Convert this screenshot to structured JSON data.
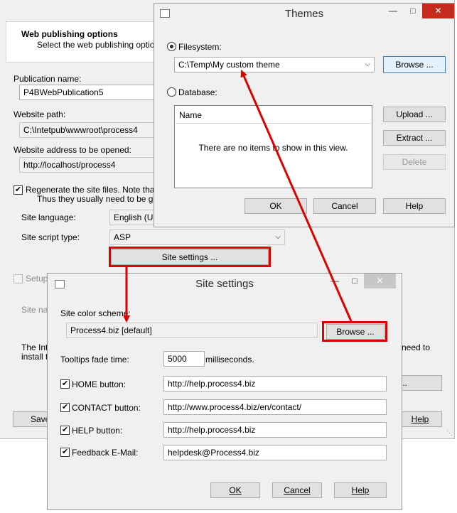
{
  "main_window": {
    "section_title": "Web publishing options",
    "section_subtitle": "Select the web publishing options.",
    "publication_name_label": "Publication name:",
    "publication_name_value": "P4BWebPublication5",
    "website_path_label": "Website path:",
    "website_path_value": "C:\\Intetpub\\wwwroot\\process4",
    "website_address_label": "Website address to be opened:",
    "website_address_value": "http://localhost/process4",
    "regenerate_label_line1": "Regenerate the site files. Note that the",
    "regenerate_label_line2": "Thus they usually need to be generate",
    "site_language_label": "Site language:",
    "site_language_value": "English (Uni",
    "site_script_type_label": "Site script type:",
    "site_script_type_value": "ASP",
    "site_settings_button": "Site settings ...",
    "setup_label": "Setup",
    "site_name_label": "Site nan",
    "info_text_line1": "The Inte",
    "info_text_line2": "install th",
    "info_text_right": "need to",
    "save_button": "Save",
    "help_button": "Help",
    "partial_button": "..."
  },
  "themes_dialog": {
    "title": "Themes",
    "filesystem_label": "Filesystem:",
    "filesystem_path": "C:\\Temp\\My custom theme",
    "browse_button": "Browse ...",
    "database_label": "Database:",
    "name_column": "Name",
    "empty_message": "There are no items to show in this view.",
    "upload_button": "Upload ...",
    "extract_button": "Extract ...",
    "delete_button": "Delete",
    "ok_button": "OK",
    "cancel_button": "Cancel",
    "help_button": "Help"
  },
  "site_settings_dialog": {
    "title": "Site settings",
    "color_scheme_label": "Site color scheme:",
    "color_scheme_value": "Process4.biz [default]",
    "browse_button": "Browse ...",
    "tooltips_label": "Tooltips fade time:",
    "tooltips_value": "5000",
    "tooltips_unit": "milliseconds.",
    "home_label": "HOME button:",
    "home_value": "http://help.process4.biz",
    "contact_label": "CONTACT button:",
    "contact_value": "http://www.process4.biz/en/contact/",
    "help_label": "HELP button:",
    "help_value": "http://help.process4.biz",
    "feedback_label": "Feedback E-Mail:",
    "feedback_value": "helpdesk@Process4.biz",
    "ok_button": "OK",
    "cancel_button": "Cancel",
    "help_button": "Help"
  },
  "titlebar": {
    "minimize": "—",
    "maximize": "□",
    "close": "✕",
    "app_icon": "window-icon"
  },
  "colors": {
    "highlight_red": "#e00000",
    "dialog_background": "#f0f0f0"
  }
}
